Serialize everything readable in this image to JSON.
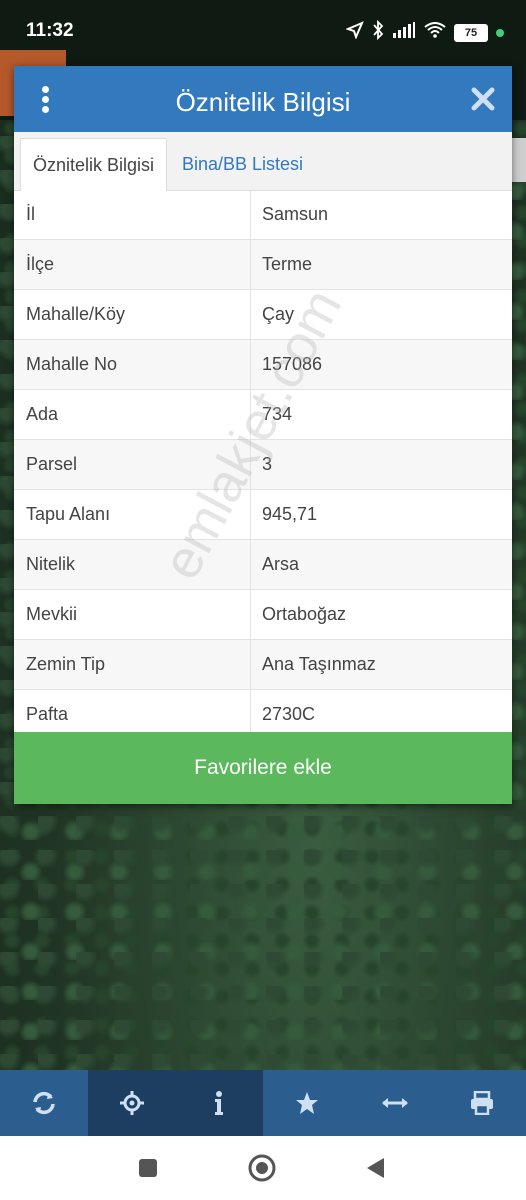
{
  "status_bar": {
    "time": "11:32",
    "battery": "75"
  },
  "dialog": {
    "title": "Öznitelik Bilgisi",
    "tabs": [
      {
        "label": "Öznitelik Bilgisi",
        "active": true
      },
      {
        "label": "Bina/BB Listesi",
        "active": false
      }
    ],
    "rows": [
      {
        "key": "İl",
        "value": "Samsun"
      },
      {
        "key": "İlçe",
        "value": "Terme"
      },
      {
        "key": "Mahalle/Köy",
        "value": "Çay"
      },
      {
        "key": "Mahalle No",
        "value": "157086"
      },
      {
        "key": "Ada",
        "value": "734"
      },
      {
        "key": "Parsel",
        "value": "3"
      },
      {
        "key": "Tapu Alanı",
        "value": "945,71"
      },
      {
        "key": "Nitelik",
        "value": "Arsa"
      },
      {
        "key": "Mevkii",
        "value": "Ortaboğaz"
      },
      {
        "key": "Zemin Tip",
        "value": "Ana Taşınmaz"
      },
      {
        "key": "Pafta",
        "value": "2730C"
      }
    ],
    "favorite_button": "Favorilere ekle"
  },
  "watermark": "emlakjet.com",
  "toolbar": {
    "items": [
      {
        "icon": "refresh-icon"
      },
      {
        "icon": "locate-icon"
      },
      {
        "icon": "info-icon"
      },
      {
        "icon": "star-icon"
      },
      {
        "icon": "measure-icon"
      },
      {
        "icon": "print-icon"
      }
    ]
  },
  "colors": {
    "header": "#3379be",
    "favorite": "#5cb85c",
    "toolbar": "#2c5d8f"
  }
}
